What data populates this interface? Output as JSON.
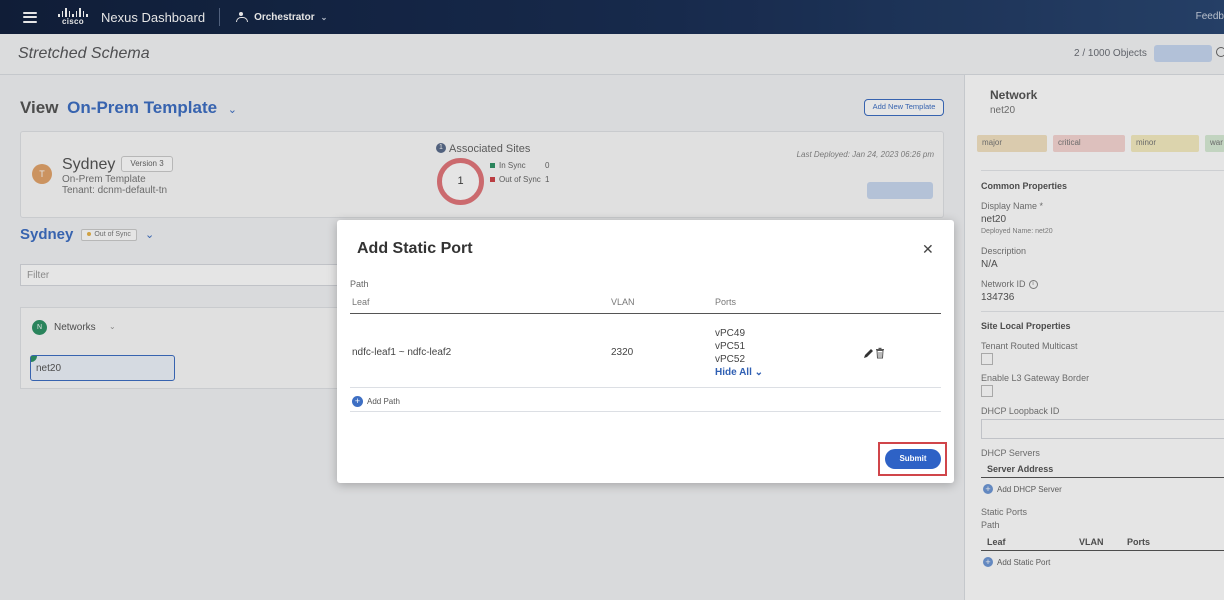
{
  "nav": {
    "brand": "cisco",
    "product": "Nexus Dashboard",
    "app": "Orchestrator",
    "feedback": "Feedb"
  },
  "header": {
    "title": "Stretched Schema",
    "object_count": "2 / 1000 Objects"
  },
  "main": {
    "view_label": "View",
    "template_name": "On-Prem Template",
    "add_template_label": "Add New Template",
    "site": {
      "avatar": "T",
      "name": "Sydney",
      "version": "Version 3",
      "template": "On-Prem Template",
      "tenant": "Tenant: dcnm-default-tn",
      "associated_sites_count": "1",
      "associated_sites_title": "Associated Sites",
      "ring_value": "1",
      "in_sync_label": "In Sync",
      "in_sync_value": "0",
      "out_of_sync_label": "Out of Sync",
      "out_of_sync_value": "1",
      "last_deployed": "Last Deployed: Jan 24, 2023 06:26 pm"
    },
    "sydney_title": "Sydney",
    "sync_badge": "Out of Sync",
    "filter_placeholder": "Filter",
    "networks": {
      "avatar": "N",
      "label": "Networks",
      "chip": "net20"
    }
  },
  "right_panel": {
    "title": "Network",
    "subtitle": "net20",
    "severities": [
      "major",
      "critical",
      "minor",
      "war"
    ],
    "common_properties": "Common Properties",
    "display_name_label": "Display Name *",
    "display_name_value": "net20",
    "deployed_name": "Deployed Name: net20",
    "description_label": "Description",
    "description_value": "N/A",
    "network_id_label": "Network ID",
    "network_id_value": "134736",
    "site_local_properties": "Site Local Properties",
    "tenant_routed_multicast": "Tenant Routed Multicast",
    "enable_l3_gateway": "Enable L3 Gateway Border",
    "dhcp_loopback_id": "DHCP Loopback ID",
    "dhcp_servers": "DHCP Servers",
    "server_address": "Server Address",
    "add_dhcp_server": "Add DHCP Server",
    "static_ports": "Static Ports",
    "path": "Path",
    "col_leaf": "Leaf",
    "col_vlan": "VLAN",
    "col_ports": "Ports",
    "add_static_port": "Add Static Port"
  },
  "modal": {
    "title": "Add Static Port",
    "path_label": "Path",
    "columns": {
      "leaf": "Leaf",
      "vlan": "VLAN",
      "ports": "Ports"
    },
    "row": {
      "leaf": "ndfc-leaf1 ~ ndfc-leaf2",
      "vlan": "2320",
      "ports": [
        "vPC49",
        "vPC51",
        "vPC52"
      ],
      "hide_all": "Hide All"
    },
    "add_path": "Add Path",
    "submit": "Submit"
  }
}
